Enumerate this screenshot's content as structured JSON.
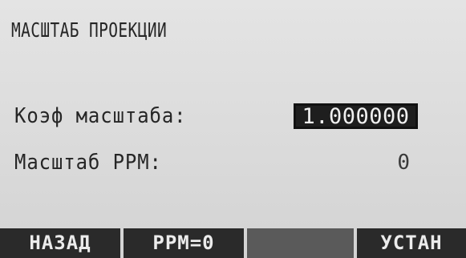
{
  "screen": {
    "title": "МАСШТАБ ПРОЕКЦИИ"
  },
  "fields": {
    "scale_factor_label": "Коэф масштаба:",
    "scale_factor_value": "1.000000",
    "ppm_label": "Масштаб PPM:",
    "ppm_value": "0"
  },
  "softkeys": {
    "back": "НАЗАД",
    "ppm_zero": "PPM=0",
    "empty": "",
    "set": "УСТАН"
  }
}
